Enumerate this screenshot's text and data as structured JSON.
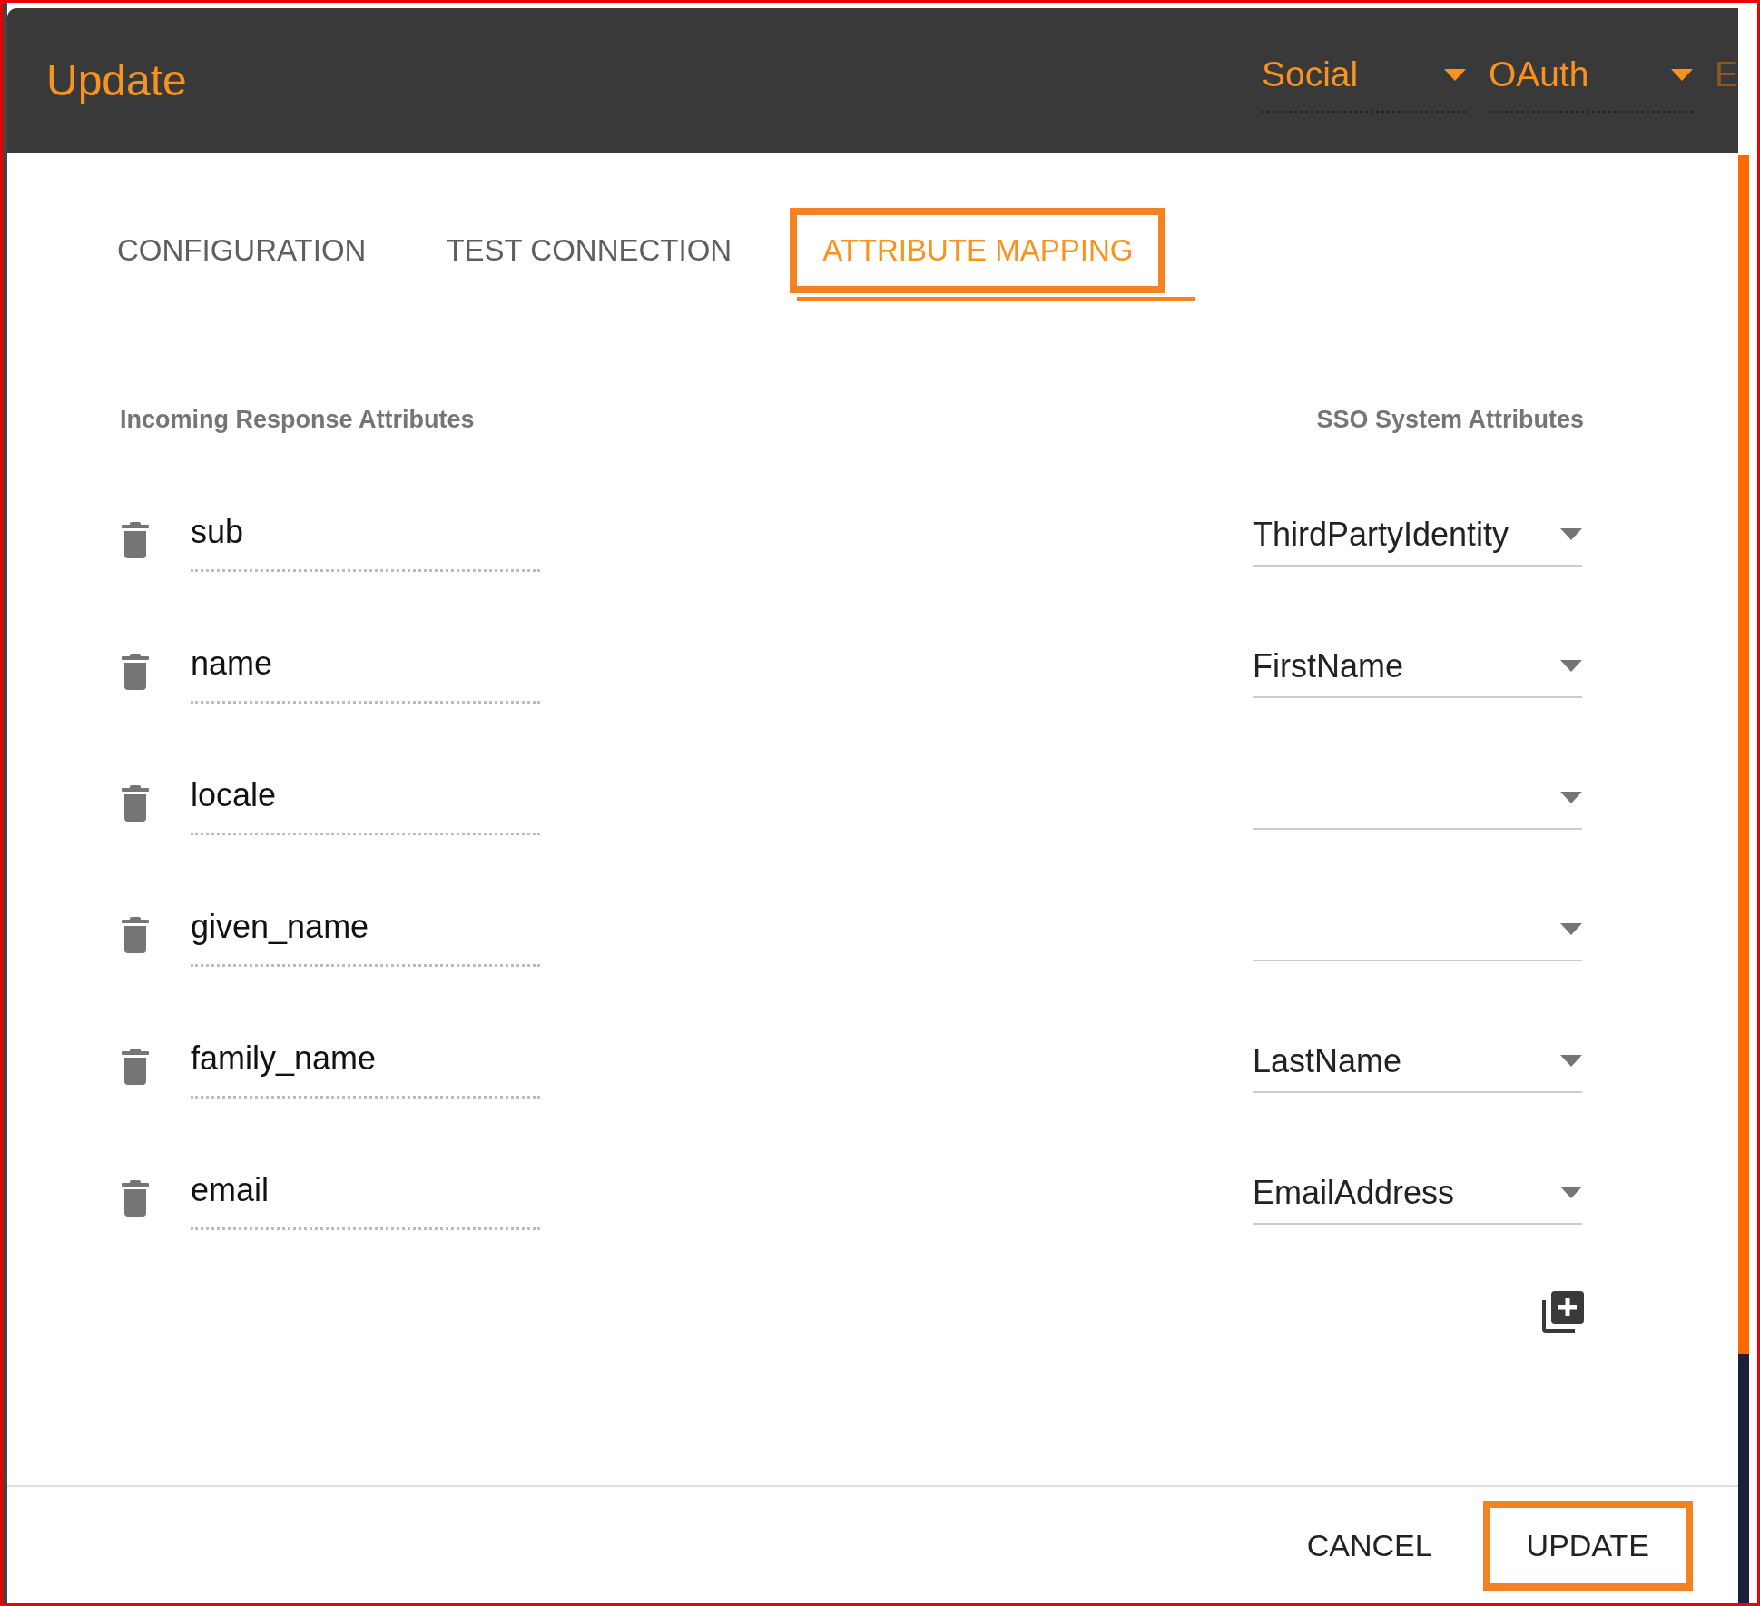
{
  "header": {
    "title": "Update",
    "selectors": [
      {
        "value": "Social"
      },
      {
        "value": "OAuth"
      }
    ],
    "cut_text": "E"
  },
  "tabs": [
    {
      "label": "CONFIGURATION",
      "selected": false,
      "highlighted": false
    },
    {
      "label": "TEST CONNECTION",
      "selected": false,
      "highlighted": false
    },
    {
      "label": "ATTRIBUTE MAPPING",
      "selected": true,
      "highlighted": true
    }
  ],
  "columns": {
    "left": "Incoming Response Attributes",
    "right": "SSO System Attributes"
  },
  "mappings": [
    {
      "incoming": "sub",
      "system": "ThirdPartyIdentity"
    },
    {
      "incoming": "name",
      "system": "FirstName"
    },
    {
      "incoming": "locale"
    },
    {
      "incoming": "given_name"
    },
    {
      "incoming": "family_name",
      "system": "LastName"
    },
    {
      "incoming": "email",
      "system": "EmailAddress"
    }
  ],
  "footer": {
    "buttons": [
      {
        "label": "CANCEL",
        "highlighted": false
      },
      {
        "label": "UPDATE",
        "highlighted": true
      }
    ]
  }
}
